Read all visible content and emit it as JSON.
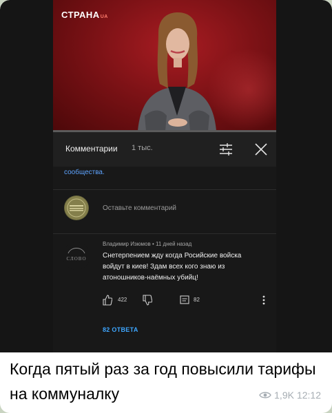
{
  "video": {
    "channel_logo": "СТРАНА",
    "channel_logo_suffix": "UA",
    "progress": 0.0
  },
  "comments": {
    "title": "Комментарии",
    "count": "1 тыс.",
    "community_text": "сообщества.",
    "add_placeholder": "Оставьте комментарий",
    "items": [
      {
        "author": "Владимир Изюмов • 11 дней назад",
        "avatar_label": "СЛОВО",
        "text": "Снетерпением жду когда Росийские войска войдут в киев! Здам всех кого знаю из атоношников-наёмных убийц!",
        "likes": "422",
        "replies_count": "82",
        "replies_link": "82 ОТВЕТА"
      }
    ]
  },
  "message": {
    "caption": "Когда пятый раз за год повысили тарифы на коммуналку",
    "views": "1,9K",
    "time": "12:12"
  },
  "colors": {
    "link_blue": "#3ea6ff",
    "video_red": "#7a0f12",
    "panel_bg": "#181818"
  }
}
